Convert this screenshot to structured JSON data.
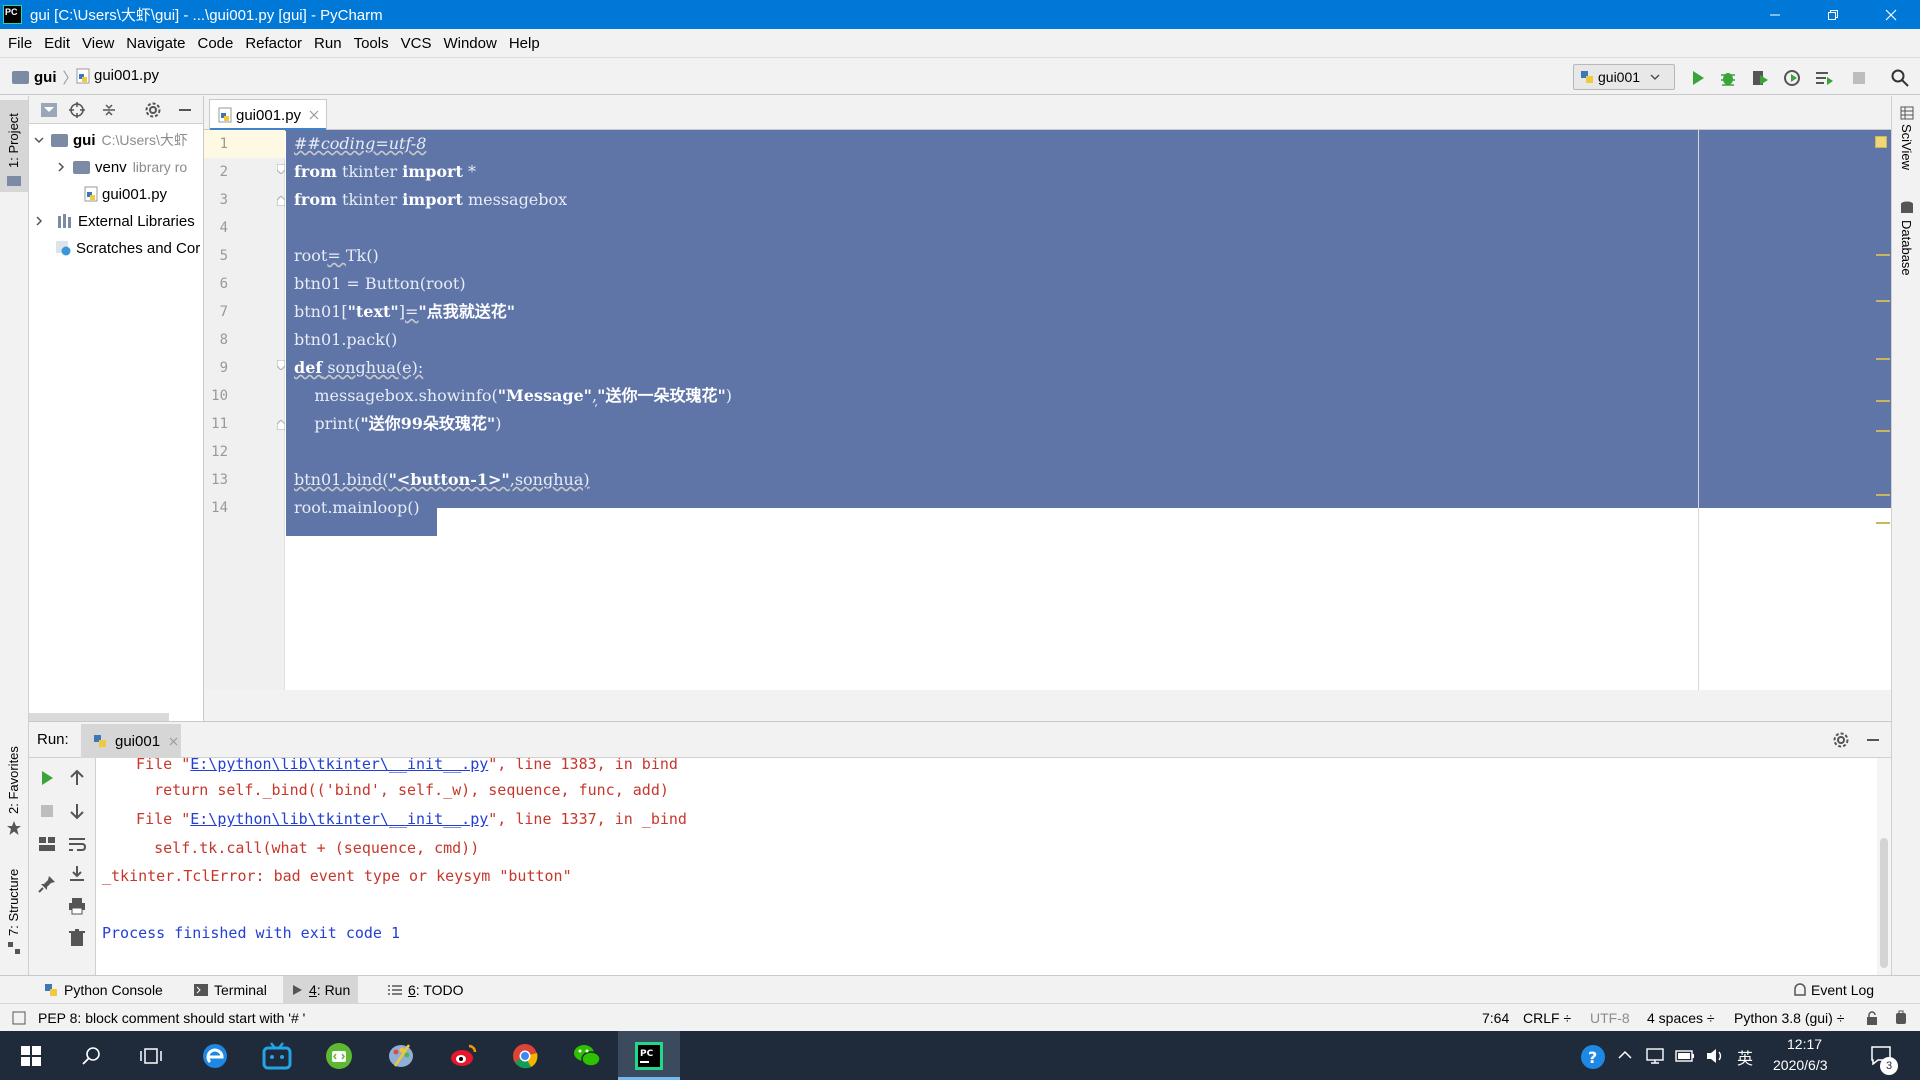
{
  "window": {
    "title": "gui [C:\\Users\\大虾\\gui] - ...\\gui001.py [gui] - PyCharm",
    "logo_text": "PC"
  },
  "menu": [
    "File",
    "Edit",
    "View",
    "Navigate",
    "Code",
    "Refactor",
    "Run",
    "Tools",
    "VCS",
    "Window",
    "Help"
  ],
  "navbar": {
    "project": "gui",
    "file": "gui001.py",
    "run_config": "gui001"
  },
  "left_stripe": {
    "project": "1: Project",
    "favorites": "2: Favorites",
    "structure": "7: Structure"
  },
  "right_stripe": {
    "sciview": "SciView",
    "database": "Database"
  },
  "project_tree": {
    "root_name": "gui",
    "root_path": "C:\\Users\\大虾",
    "venv": "venv",
    "venv_note": "library ro",
    "file": "gui001.py",
    "ext_libs": "External Libraries",
    "scratches": "Scratches and Cor"
  },
  "editor": {
    "tab": "gui001.py",
    "line_numbers": [
      "1",
      "2",
      "3",
      "4",
      "5",
      "6",
      "7",
      "8",
      "9",
      "10",
      "11",
      "12",
      "13",
      "14"
    ]
  },
  "run": {
    "label": "Run:",
    "tab": "gui001",
    "console": {
      "l1_a": "  File \"",
      "l1_link": "E:\\python\\lib\\tkinter\\__init__.py",
      "l1_b": "\", line 1383, in bind",
      "l2": "    return self._bind(('bind', self._w), sequence, func, add)",
      "l3_a": "  File \"",
      "l3_link": "E:\\python\\lib\\tkinter\\__init__.py",
      "l3_b": "\", line 1337, in _bind",
      "l4": "    self.tk.call(what + (sequence, cmd))",
      "l5": "_tkinter.TclError: bad event type or keysym \"button\"",
      "l6": "Process finished with exit code 1"
    }
  },
  "tool_tabs": {
    "python_console": "Python Console",
    "terminal": "Terminal",
    "run_num": "4",
    "run_label": ": Run",
    "todo_num": "6",
    "todo_label": ": TODO",
    "event_log": "Event Log"
  },
  "status": {
    "message": "PEP 8: block comment should start with '# '",
    "position": "7:64",
    "line_sep": "CRLF ÷",
    "encoding": "UTF-8",
    "indent": "4 spaces ÷",
    "interpreter": "Python 3.8 (gui) ÷"
  },
  "taskbar": {
    "ime": "英",
    "time": "12:17",
    "date": "2020/6/3",
    "notif_count": "3"
  },
  "colors": {
    "titlebar": "#0078d7",
    "selection": "#5f75a8",
    "taskbar": "#1f2a3a",
    "error_text": "#c7372c",
    "link": "#2440d3"
  }
}
